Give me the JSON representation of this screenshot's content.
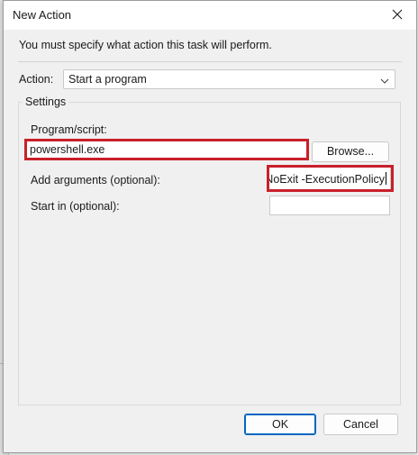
{
  "dialog": {
    "title": "New Action",
    "close_icon": "close-icon",
    "instruction": "You must specify what action this task will perform."
  },
  "action": {
    "label": "Action:",
    "selected": "Start a program",
    "dropdown_icon": "chevron-down-icon"
  },
  "settings": {
    "group_label": "Settings",
    "program_label": "Program/script:",
    "program_value": "powershell.exe",
    "browse_label": "Browse...",
    "arguments_label": "Add arguments (optional):",
    "arguments_value": "-NoExit -ExecutionPolicy",
    "start_in_label": "Start in (optional):",
    "start_in_value": ""
  },
  "buttons": {
    "ok": "OK",
    "cancel": "Cancel"
  },
  "colors": {
    "highlight": "#c8202a",
    "accent": "#0067c0"
  }
}
